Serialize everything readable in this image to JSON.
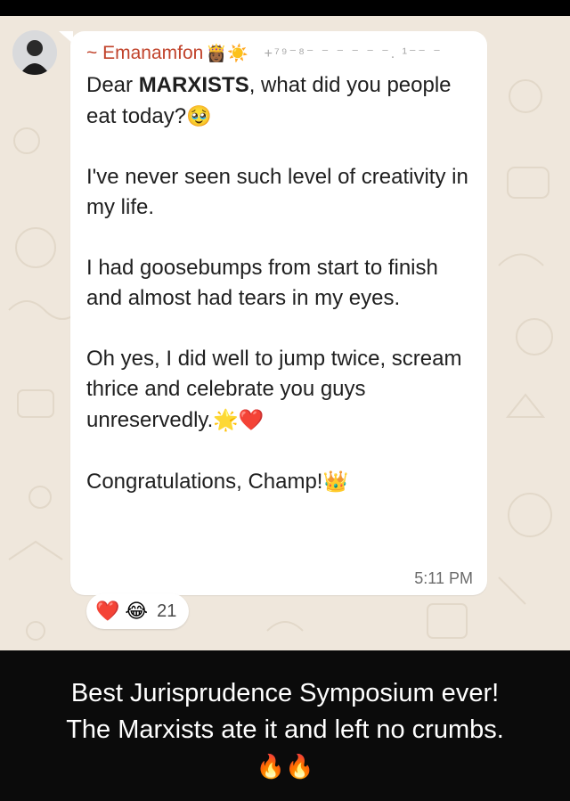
{
  "chat": {
    "sender": {
      "prefix": "~",
      "name": "Emanamfon",
      "emojis": "👸🏾☀️",
      "phone": "+⁷⁹⁻⁸⁻ ⁻ ⁻ ⁻ ⁻ ⁻. ¹⁻⁻ ⁻"
    },
    "message": {
      "line1_pre": "Dear ",
      "line1_bold": "MARXISTS",
      "line1_post": ", what did you people eat today?",
      "line1_emoji": "🥹",
      "para2": "I've never seen such level of creativity in my life.",
      "para3": "I had goosebumps from start to finish and almost had tears in my eyes.",
      "para4": "Oh yes, I did well to jump twice, scream thrice and celebrate you guys unreservedly.",
      "para4_emoji": "🌟❤️",
      "para5": "Congratulations, Champ!",
      "para5_emoji": "👑"
    },
    "timestamp": "5:11 PM",
    "reactions": {
      "emojis": [
        "❤️",
        "😂"
      ],
      "count": "21"
    }
  },
  "caption": {
    "line1": "Best Jurisprudence Symposium ever!",
    "line2": "The Marxists ate it and left no crumbs.",
    "emojis": "🔥🔥"
  },
  "colors": {
    "chat_background": "#efe7dc",
    "bubble": "#ffffff",
    "sender_name": "#c1432b",
    "caption_background": "#0b0b0b"
  }
}
